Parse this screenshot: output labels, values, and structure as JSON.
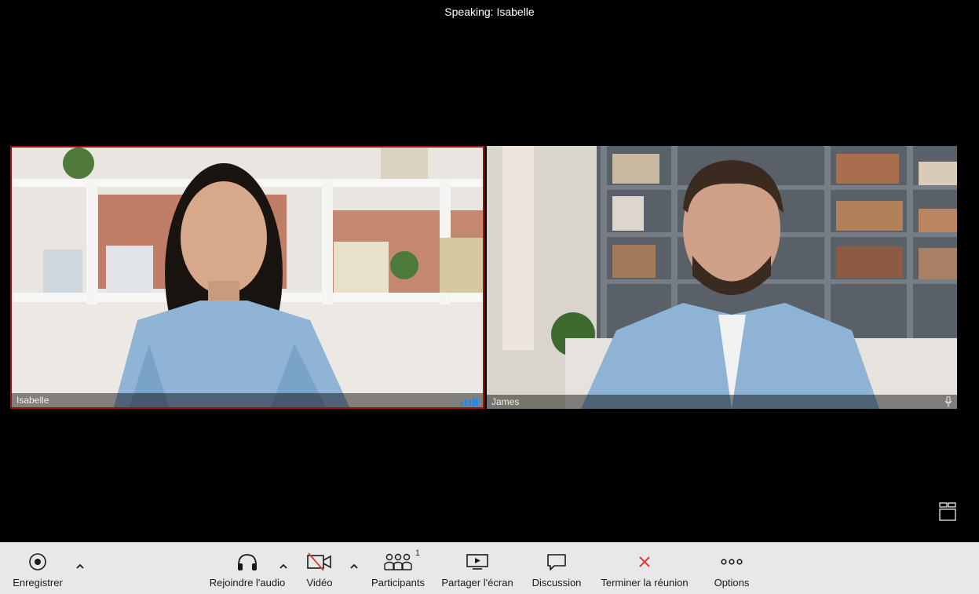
{
  "header": {
    "speaking": "Speaking: Isabelle"
  },
  "tiles": [
    {
      "name": "Isabelle",
      "active_speaker": true,
      "indicator": "audio-level-icon"
    },
    {
      "name": "James",
      "active_speaker": false,
      "indicator": "microphone-icon"
    }
  ],
  "toolbar": {
    "record": {
      "label": "Enregistrer",
      "icon": "record-icon"
    },
    "audio": {
      "label": "Rejoindre l'audio",
      "icon": "headphones-icon"
    },
    "video": {
      "label": "Vidéo",
      "icon": "video-off-icon"
    },
    "participants": {
      "label": "Participants",
      "count": "1",
      "icon": "participants-icon"
    },
    "share": {
      "label": "Partager l'écran",
      "icon": "share-screen-icon"
    },
    "chat": {
      "label": "Discussion",
      "icon": "chat-icon"
    },
    "end": {
      "label": "Terminer la réunion",
      "icon": "close-icon"
    },
    "options": {
      "label": "Options",
      "icon": "more-icon"
    }
  },
  "colors": {
    "active_border": "#a01010",
    "end_red": "#e03a3a",
    "level_blue": "#1e88e5",
    "toolbar_bg": "#e8e8e8"
  }
}
